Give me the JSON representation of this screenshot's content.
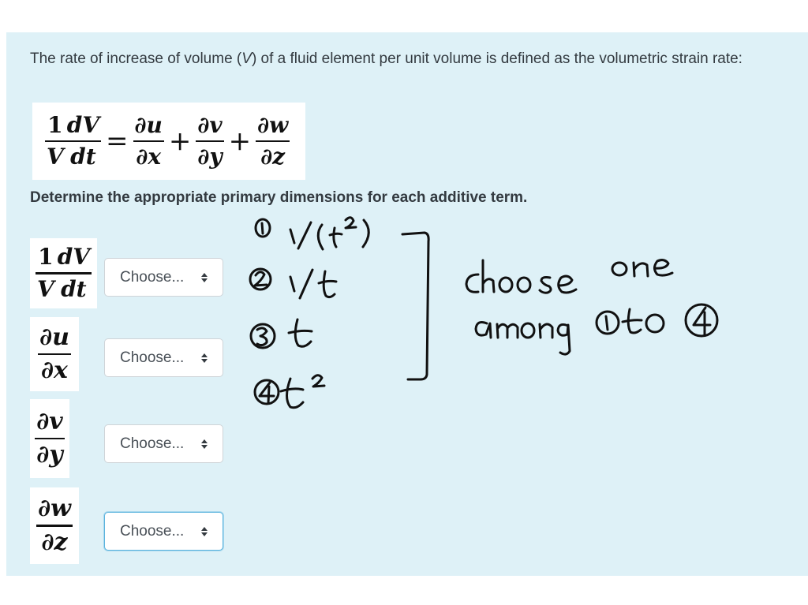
{
  "question": {
    "text_before": "The rate of increase of volume (",
    "var": "V",
    "text_after": ") of a fluid element per unit volume is defined as the volumetric strain rate:",
    "instruction": "Determine the appropriate primary dimensions for each additive term."
  },
  "equation": {
    "lhs": {
      "numer_1": "1",
      "numer_2": "dV",
      "denom_1": "V",
      "denom_2": "dt"
    },
    "equals": "=",
    "plus": "+",
    "terms": [
      {
        "num": "∂u",
        "den": "∂x"
      },
      {
        "num": "∂v",
        "den": "∂y"
      },
      {
        "num": "∂w",
        "den": "∂z"
      }
    ]
  },
  "rows": [
    {
      "num": "∂u",
      "den": "∂x",
      "select_value": "Choose..."
    },
    {
      "num": "∂v",
      "den": "∂y",
      "select_value": "Choose..."
    },
    {
      "num": "∂w",
      "den": "∂z",
      "select_value": "Choose..."
    }
  ],
  "row0": {
    "select_value": "Choose..."
  },
  "handwriting": {
    "options": [
      "① 1/(t²)",
      "② 1/t",
      "③ t",
      "④ t²"
    ],
    "note_line1": "choose one",
    "note_line2": "among ① to ④"
  },
  "colors": {
    "panel": "#def1f7",
    "focus": "#5ab3dd",
    "ink": "#111111"
  }
}
